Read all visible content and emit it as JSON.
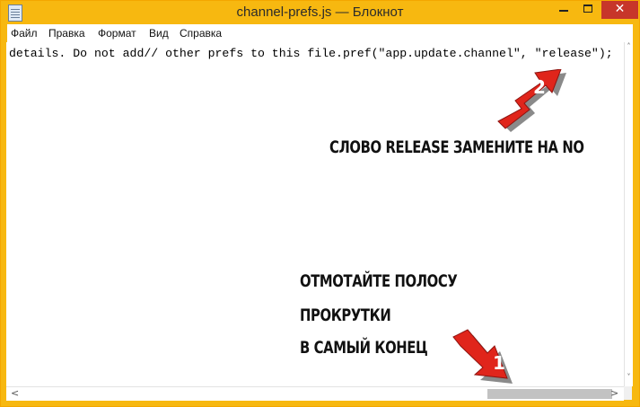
{
  "window": {
    "title": "channel-prefs.js — Блокнот",
    "app_icon": "notepad-icon",
    "close_glyph": "✕",
    "colors": {
      "frame": "#f7b810",
      "close": "#c7362a"
    }
  },
  "menu": {
    "items": [
      {
        "label": "Файл"
      },
      {
        "label": "Правка"
      },
      {
        "label": "Формат"
      },
      {
        "label": "Вид"
      },
      {
        "label": "Справка"
      }
    ]
  },
  "editor": {
    "visible_line": "details. Do not add// other prefs to this file.pref(\"app.update.channel\", \"release\");"
  },
  "scrollbars": {
    "up_glyph": "˄",
    "down_glyph": "˅",
    "left_glyph": "<",
    "right_glyph": ">",
    "horizontal_position": 1.0
  },
  "annotations": {
    "step2_text": "СЛОВО RELEASE ЗАМЕНИТЕ НА NO",
    "step1_lines": [
      "ОТМОТАЙТЕ ПОЛОСУ",
      "ПРОКРУТКИ",
      "В САМЫЙ КОНЕЦ"
    ],
    "marker1": "1",
    "marker2": "2",
    "marker_color": "#e0251b"
  }
}
